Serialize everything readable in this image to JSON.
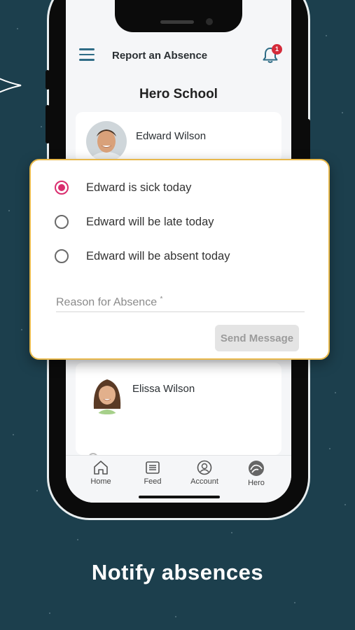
{
  "header": {
    "title": "Report an Absence",
    "notification_count": "1"
  },
  "school": {
    "name": "Hero School"
  },
  "students": [
    {
      "name": "Edward Wilson"
    },
    {
      "name": "Elissa Wilson"
    }
  ],
  "popup": {
    "options": [
      {
        "label": "Edward is sick today",
        "selected": true
      },
      {
        "label": "Edward will be late today",
        "selected": false
      },
      {
        "label": "Edward will be absent today",
        "selected": false
      }
    ],
    "reason_label": "Reason for Absence",
    "required_mark": "*",
    "send_label": "Send Message"
  },
  "nav": [
    {
      "label": "Home",
      "icon": "home-icon"
    },
    {
      "label": "Feed",
      "icon": "feed-icon"
    },
    {
      "label": "Account",
      "icon": "account-icon"
    },
    {
      "label": "Hero",
      "icon": "hero-logo-icon"
    }
  ],
  "caption": "Notify absences",
  "colors": {
    "background": "#1c3f4d",
    "accent": "#d92d6e",
    "popup_border": "#e8b84a",
    "header_icon": "#2f6c86"
  }
}
